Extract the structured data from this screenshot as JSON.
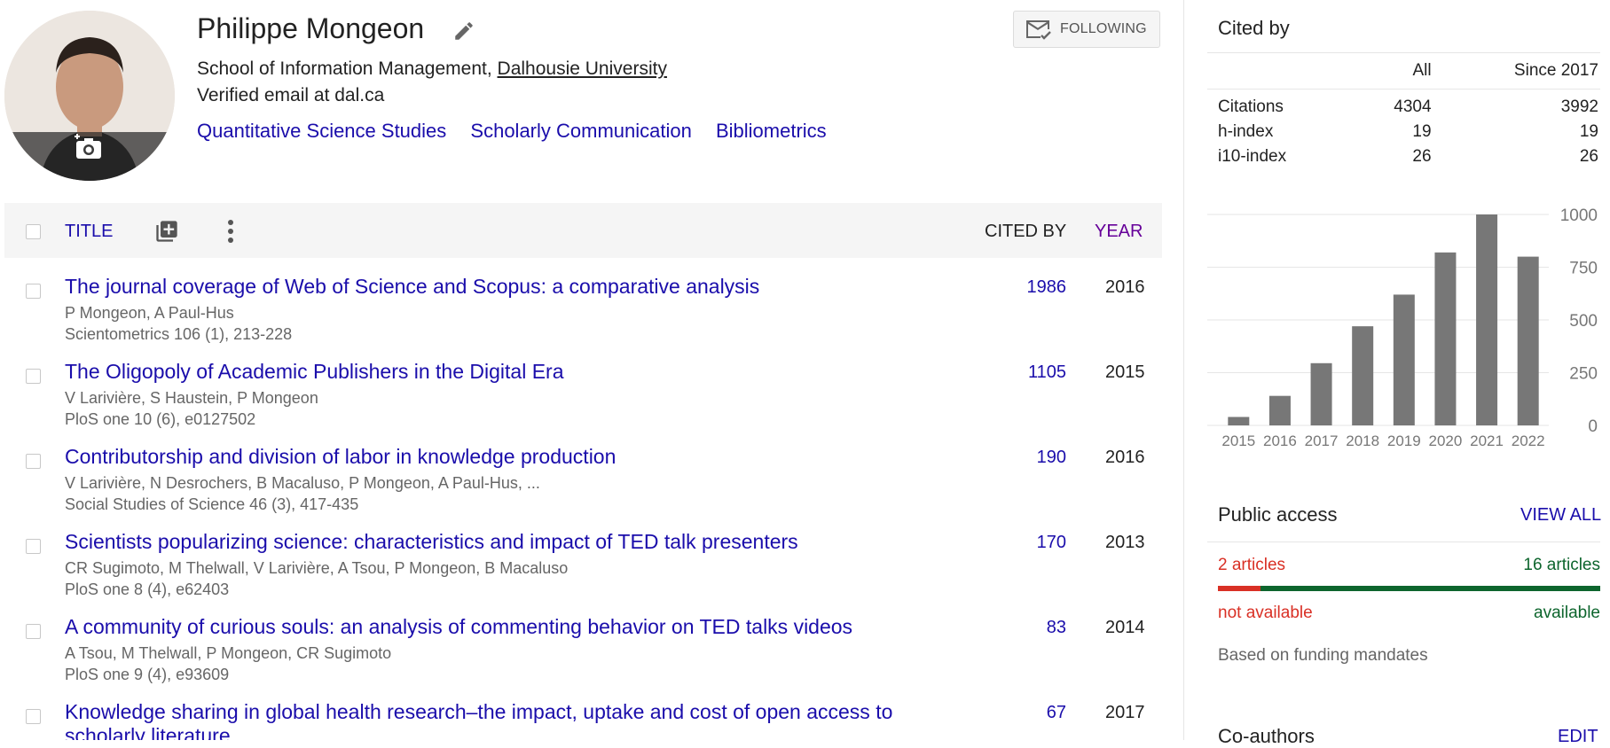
{
  "profile": {
    "name": "Philippe Mongeon",
    "affiliation_prefix": "School of Information Management, ",
    "affiliation_link": "Dalhousie University",
    "verified": "Verified email at dal.ca",
    "interests": [
      "Quantitative Science Studies",
      "Scholarly Communication",
      "Bibliometrics"
    ],
    "follow_label": "FOLLOWING"
  },
  "table": {
    "header": {
      "title": "TITLE",
      "cited_by": "CITED BY",
      "year": "YEAR"
    },
    "rows": [
      {
        "title": "The journal coverage of Web of Science and Scopus: a comparative analysis",
        "authors": "P Mongeon, A Paul-Hus",
        "venue": "Scientometrics 106 (1), 213-228",
        "cited": "1986",
        "year": "2016"
      },
      {
        "title": "The Oligopoly of Academic Publishers in the Digital Era",
        "authors": "V Larivière, S Haustein, P Mongeon",
        "venue": "PloS one 10 (6), e0127502",
        "cited": "1105",
        "year": "2015"
      },
      {
        "title": "Contributorship and division of labor in knowledge production",
        "authors": "V Larivière, N Desrochers, B Macaluso, P Mongeon, A Paul-Hus, ...",
        "venue": "Social Studies of Science 46 (3), 417-435",
        "cited": "190",
        "year": "2016"
      },
      {
        "title": "Scientists popularizing science: characteristics and impact of TED talk presenters",
        "authors": "CR Sugimoto, M Thelwall, V Larivière, A Tsou, P Mongeon, B Macaluso",
        "venue": "PloS one 8 (4), e62403",
        "cited": "170",
        "year": "2013"
      },
      {
        "title": "A community of curious souls: an analysis of commenting behavior on TED talks videos",
        "authors": "A Tsou, M Thelwall, P Mongeon, CR Sugimoto",
        "venue": "PloS one 9 (4), e93609",
        "cited": "83",
        "year": "2014"
      },
      {
        "title": "Knowledge sharing in global health research–the impact, uptake and cost of open access to scholarly literature",
        "authors": "",
        "venue": "",
        "cited": "67",
        "year": "2017"
      }
    ]
  },
  "cited_by": {
    "heading": "Cited by",
    "col_all": "All",
    "col_since": "Since 2017",
    "metrics": [
      {
        "label": "Citations",
        "all": "4304",
        "since": "3992"
      },
      {
        "label": "h-index",
        "all": "19",
        "since": "19"
      },
      {
        "label": "i10-index",
        "all": "26",
        "since": "26"
      }
    ]
  },
  "chart_data": {
    "type": "bar",
    "categories": [
      "2015",
      "2016",
      "2017",
      "2018",
      "2019",
      "2020",
      "2021",
      "2022"
    ],
    "values": [
      40,
      140,
      295,
      470,
      620,
      820,
      1000,
      800
    ],
    "ylim": [
      0,
      1000
    ],
    "yticks": [
      "0",
      "250",
      "500",
      "750",
      "1000"
    ],
    "bar_color": "#777777",
    "grid": true
  },
  "public_access": {
    "heading": "Public access",
    "view_all": "VIEW ALL",
    "not_available_count": "2 articles",
    "available_count": "16 articles",
    "not_available_label": "not available",
    "available_label": "available",
    "note": "Based on funding mandates",
    "not_available_fraction": 0.111
  },
  "coauthors": {
    "heading": "Co-authors",
    "edit": "EDIT"
  },
  "colors": {
    "link": "#1a0dab",
    "year_sort": "#660099",
    "not_available": "#d93025",
    "available": "#0d652d"
  }
}
